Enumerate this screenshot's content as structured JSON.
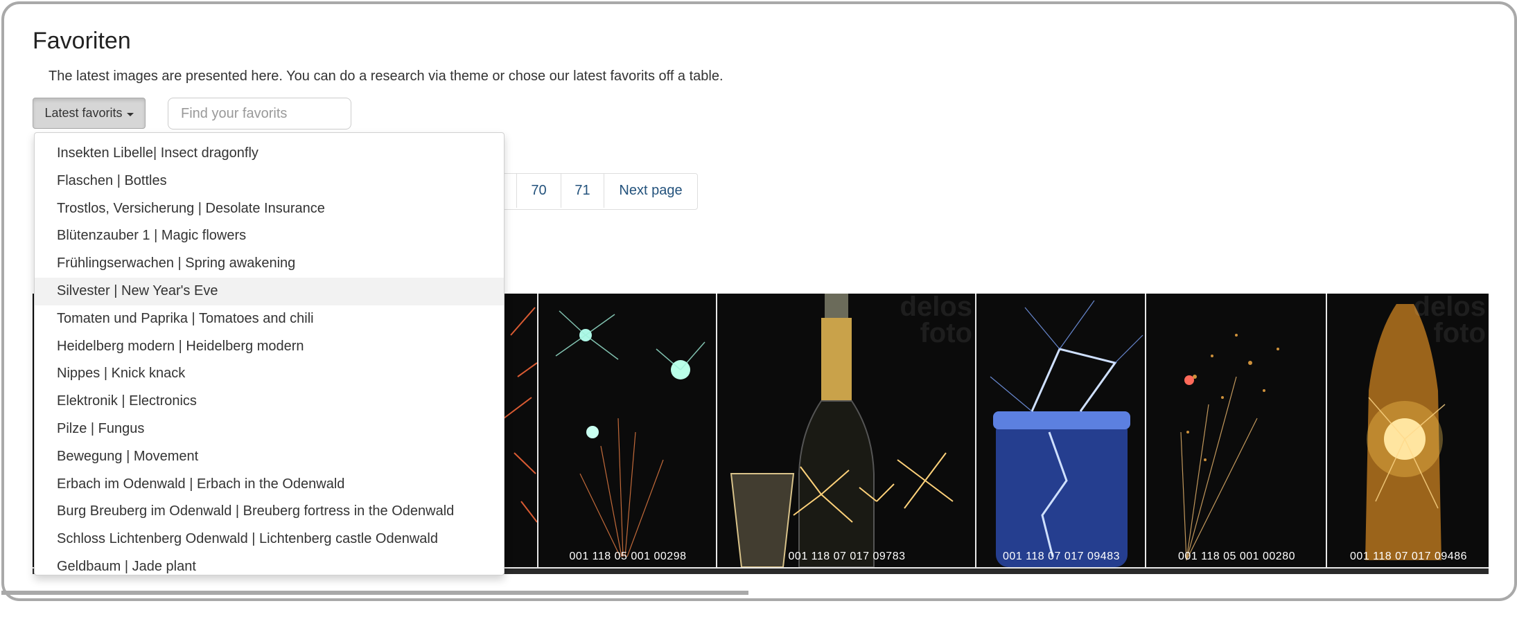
{
  "page": {
    "title": "Favoriten",
    "intro": "The latest images are presented here. You can do a research via theme or chose our latest favorits off a table."
  },
  "controls": {
    "dropdown_label": "Latest favorits",
    "search_placeholder": "Find your favorits"
  },
  "pagination": {
    "items": [
      "70",
      "71",
      "Next page"
    ]
  },
  "menu": {
    "items": [
      "Insekten Libelle| Insect dragonfly",
      "Flaschen | Bottles",
      "Trostlos, Versicherung | Desolate Insurance",
      "Blütenzauber 1 | Magic flowers",
      "Frühlingserwachen | Spring awakening",
      "Silvester | New Year's Eve",
      "Tomaten und Paprika | Tomatoes and chili",
      "Heidelberg modern | Heidelberg modern",
      "Nippes | Knick knack",
      "Elektronik | Electronics",
      "Pilze | Fungus",
      "Bewegung | Movement",
      "Erbach im Odenwald | Erbach in the Odenwald",
      "Burg Breuberg im Odenwald | Breuberg fortress in the Odenwald",
      "Schloss Lichtenberg Odenwald | Lichtenberg castle Odenwald",
      "Geldbaum | Jade plant"
    ],
    "active_index": 5
  },
  "gallery": {
    "watermark": "delos foto",
    "images": [
      {
        "code": "",
        "accent": "#ff6a3a"
      },
      {
        "code": "001 118 05 001 00298",
        "accent": "#ff7a40"
      },
      {
        "code": "001 118 07 017 09783",
        "accent": "#ffd27a"
      },
      {
        "code": "001 118 07 017 09483",
        "accent": "#4a7dff"
      },
      {
        "code": "001 118 05 001 00280",
        "accent": "#ffb347"
      },
      {
        "code": "001 118 07 017 09486",
        "accent": "#ffc04d"
      }
    ]
  }
}
